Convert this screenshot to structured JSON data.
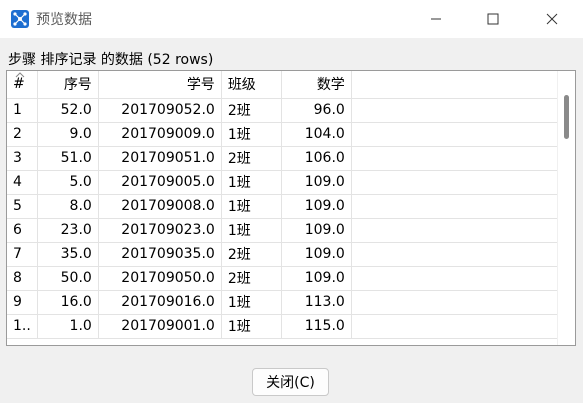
{
  "window": {
    "title": "预览数据"
  },
  "caption": "步骤 排序记录 的数据  (52 rows)",
  "table": {
    "headers": [
      "#",
      "序号",
      "学号",
      "班级",
      "数学"
    ],
    "rows": [
      [
        "1",
        "52.0",
        "201709052.0",
        "2班",
        "96.0"
      ],
      [
        "2",
        "9.0",
        "201709009.0",
        "1班",
        "104.0"
      ],
      [
        "3",
        "51.0",
        "201709051.0",
        "2班",
        "106.0"
      ],
      [
        "4",
        "5.0",
        "201709005.0",
        "1班",
        "109.0"
      ],
      [
        "5",
        "8.0",
        "201709008.0",
        "1班",
        "109.0"
      ],
      [
        "6",
        "23.0",
        "201709023.0",
        "1班",
        "109.0"
      ],
      [
        "7",
        "35.0",
        "201709035.0",
        "2班",
        "109.0"
      ],
      [
        "8",
        "50.0",
        "201709050.0",
        "2班",
        "109.0"
      ],
      [
        "9",
        "16.0",
        "201709016.0",
        "1班",
        "113.0"
      ],
      [
        "1..",
        "1.0",
        "201709001.0",
        "1班",
        "115.0"
      ]
    ]
  },
  "buttons": {
    "close": "关闭(C)"
  }
}
